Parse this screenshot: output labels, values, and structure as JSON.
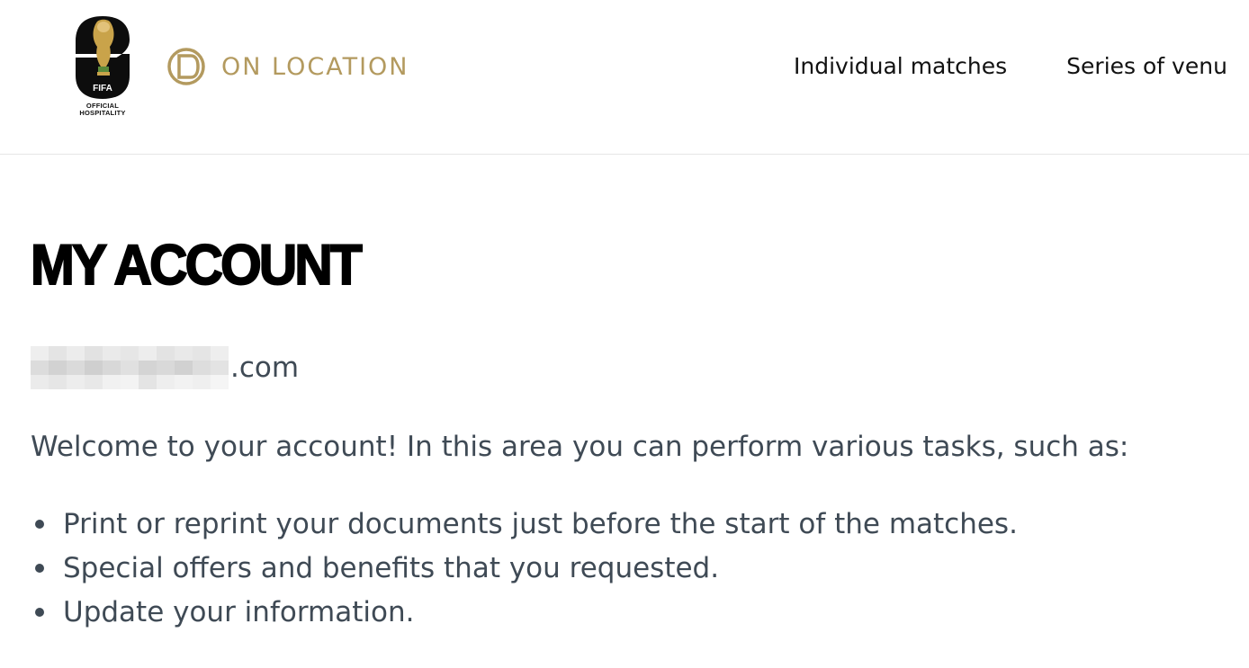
{
  "header": {
    "fifa_logo": {
      "mark_text": "FIFA",
      "subtitle_line1": "OFFICIAL",
      "subtitle_line2": "HOSPITALITY",
      "icon": "fifa-world-cup-26-logo"
    },
    "brand": {
      "name": "ON LOCATION",
      "icon": "on-location-logo",
      "color": "#b39a5f"
    },
    "nav": [
      {
        "label": "Individual matches"
      },
      {
        "label": "Series of venu"
      }
    ]
  },
  "main": {
    "title": "MY ACCOUNT",
    "email": {
      "domain_suffix": ".com"
    },
    "welcome_text": "Welcome to your account! In this area you can perform various tasks, such as:",
    "tasks": [
      {
        "text": "Print or reprint your documents just before the start of the matches."
      },
      {
        "text": "Special offers and benefits that you requested."
      },
      {
        "text": "Update your information."
      }
    ]
  },
  "colors": {
    "body_text": "#3f4a55",
    "title": "#000000",
    "nav_text": "#111111",
    "gold": "#b39a5f"
  }
}
